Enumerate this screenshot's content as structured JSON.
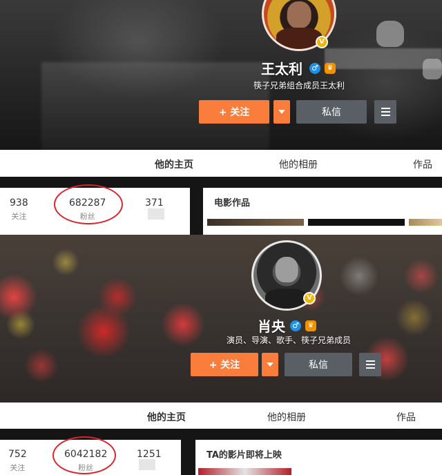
{
  "profiles": [
    {
      "name": "王太利",
      "description": "筷子兄弟组合成员王太利",
      "follow_label": "+ 关注",
      "message_label": "私信",
      "verified_badge": "V",
      "gender_symbol": "♂",
      "tabs": [
        "他的主页",
        "他的相册",
        "作品"
      ],
      "stats": {
        "following": {
          "value": "938",
          "label": "关注"
        },
        "fans": {
          "value": "682287",
          "label": "粉丝"
        },
        "posts": {
          "value": "371"
        }
      },
      "card_title": "电影作品"
    },
    {
      "name": "肖央",
      "description": "演员、导演、歌手、筷子兄弟成员",
      "follow_label": "+ 关注",
      "message_label": "私信",
      "verified_badge": "V",
      "gender_symbol": "♂",
      "tabs": [
        "他的主页",
        "他的相册",
        "作品"
      ],
      "stats": {
        "following": {
          "value": "752",
          "label": "关注"
        },
        "fans": {
          "value": "6042182",
          "label": "粉丝"
        },
        "posts": {
          "value": "1251"
        }
      },
      "card_title": "TA的影片即将上映"
    }
  ],
  "colors": {
    "accent_orange": "#fa7d3c",
    "secondary_gray": "#5a5f66",
    "highlight_ring": "#d9242b",
    "verified_gold": "#f5b400",
    "gender_blue": "#1e90e6"
  },
  "icons": [
    "verified-badge-icon",
    "male-gender-icon",
    "fan-badge-icon",
    "chevron-down-icon",
    "menu-icon"
  ]
}
